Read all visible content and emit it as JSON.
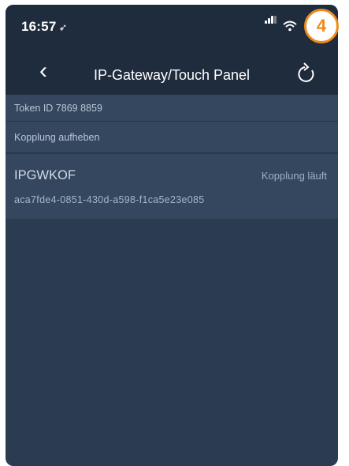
{
  "status_bar": {
    "time": "16:57",
    "location_icon": "location-arrow-icon",
    "signal_icon": "cellular-signal-icon",
    "wifi_icon": "wifi-icon"
  },
  "nav": {
    "back_icon": "chevron-left-icon",
    "title": "IP-Gateway/Touch Panel",
    "refresh_icon": "refresh-icon"
  },
  "rows": {
    "token": "Token ID 7869 8859",
    "unpair": "Kopplung aufheben"
  },
  "device": {
    "name": "IPGWKOF",
    "status": "Kopplung läuft",
    "id": "aca7fde4-0851-430d-a598-f1ca5e23e085"
  },
  "annotation": {
    "number": "4"
  },
  "colors": {
    "bar_bg": "#1f2c3d",
    "screen_bg": "#2b3c51",
    "row_bg": "#34475e",
    "badge_accent": "#f08a1c"
  }
}
